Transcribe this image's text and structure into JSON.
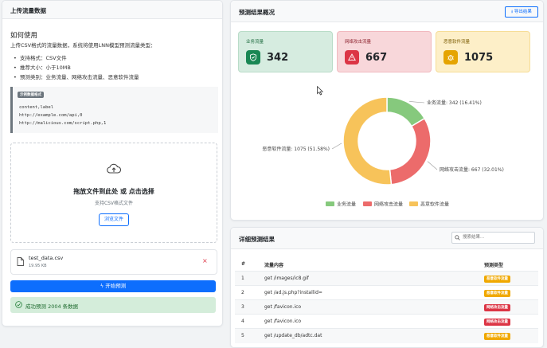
{
  "upload": {
    "title": "上传流量数据",
    "how_to_title": "如何使用",
    "intro": "上传CSV格式的流量数据，系统将使用LNN模型预测流量类型：",
    "bullets": [
      "支持格式：CSV文件",
      "推荐大小：小于10MB",
      "预测类别：业务流量、网络攻击流量、恶意软件流量"
    ],
    "example_badge": "示例数据格式",
    "example_lines": [
      "content,label",
      "http://example.com/api,0",
      "http://malicious.com/script.php,1"
    ],
    "drop_title": "拖放文件到此处 或 点击选择",
    "drop_sub": "支持CSV格式文件",
    "browse_label": "浏览文件",
    "file_name": "test_data.csv",
    "file_size": "19.95 KB",
    "remove_glyph": "×",
    "start_label": "开始预测",
    "success_text": "成功预测 2004 条数据"
  },
  "overview": {
    "title": "预测结果概况",
    "export_label": "导出结果",
    "stats": [
      {
        "label": "业务流量",
        "value": "342",
        "icon": "shield-check-icon",
        "bg": "#d6ece0",
        "border": "#b9dcc8",
        "icon_bg": "#198754"
      },
      {
        "label": "网络攻击流量",
        "value": "667",
        "icon": "warning-triangle-icon",
        "bg": "#f8d7da",
        "border": "#f1b9bf",
        "icon_bg": "#dc3545"
      },
      {
        "label": "恶意软件流量",
        "value": "1075",
        "icon": "bug-icon",
        "bg": "#fdefc8",
        "border": "#f6dd97",
        "icon_bg": "#e5a400"
      }
    ]
  },
  "chart_data": {
    "type": "pie",
    "categories": [
      "业务流量",
      "网络攻击流量",
      "恶意软件流量"
    ],
    "values": [
      342,
      667,
      1075
    ],
    "percent_labels": [
      "业务流量: 342 (16.41%)",
      "网络攻击流量: 667 (32.01%)",
      "恶意软件流量: 1075 (51.58%)"
    ],
    "colors": [
      "#86c97d",
      "#ec6b6b",
      "#f7c35a"
    ],
    "legend_placement": "bottom",
    "donut": true
  },
  "details": {
    "title": "详细预测结果",
    "search_placeholder": "搜索结果...",
    "columns": [
      "#",
      "流量内容",
      "预测类型"
    ],
    "rows": [
      {
        "n": "1",
        "content": "get /images/ic8.gif",
        "type": "恶意软件流量",
        "color": "#f0a800"
      },
      {
        "n": "2",
        "content": "get /ad.js.php?installid=",
        "type": "恶意软件流量",
        "color": "#f0a800"
      },
      {
        "n": "3",
        "content": "get /favicon.ico",
        "type": "网络攻击流量",
        "color": "#dc3545"
      },
      {
        "n": "4",
        "content": "get /favicon.ico",
        "type": "网络攻击流量",
        "color": "#dc3545"
      },
      {
        "n": "5",
        "content": "get /update_db/adtc.dat",
        "type": "恶意软件流量",
        "color": "#f0a800"
      }
    ]
  }
}
